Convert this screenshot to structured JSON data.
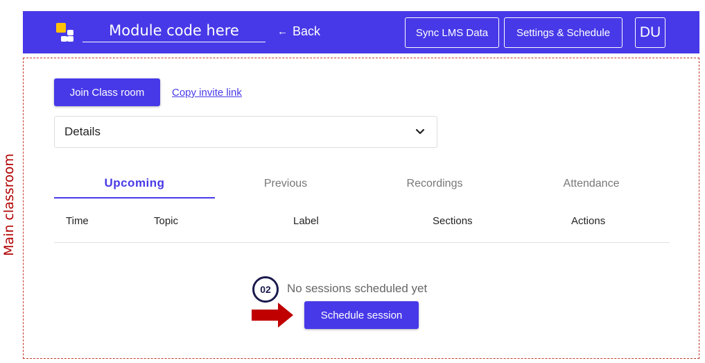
{
  "annotation": {
    "side_label": "Main classroom",
    "step_number": "02"
  },
  "header": {
    "module_placeholder": "Module code here",
    "back_label": "Back",
    "sync_label": "Sync LMS Data",
    "settings_label": "Settings & Schedule",
    "avatar_initials": "DU",
    "logo_icon": "app-logo-icon",
    "back_icon": "arrow-left-icon"
  },
  "classroom": {
    "join_label": "Join Class room",
    "copy_invite_label": "Copy invite link",
    "details_label": "Details",
    "details_icon": "chevron-down-icon"
  },
  "tabs": [
    {
      "label": "Upcoming",
      "active": true
    },
    {
      "label": "Previous",
      "active": false
    },
    {
      "label": "Recordings",
      "active": false
    },
    {
      "label": "Attendance",
      "active": false
    }
  ],
  "table": {
    "columns": [
      "Time",
      "Topic",
      "Label",
      "Sections",
      "Actions"
    ],
    "empty_text": "No sessions scheduled yet",
    "schedule_label": "Schedule session"
  },
  "colors": {
    "brand": "#4739e8",
    "logo_accent": "#ffc107",
    "annotation_red": "#b00000",
    "arrow_red": "#c00000",
    "badge_navy": "#1a1a4e"
  }
}
